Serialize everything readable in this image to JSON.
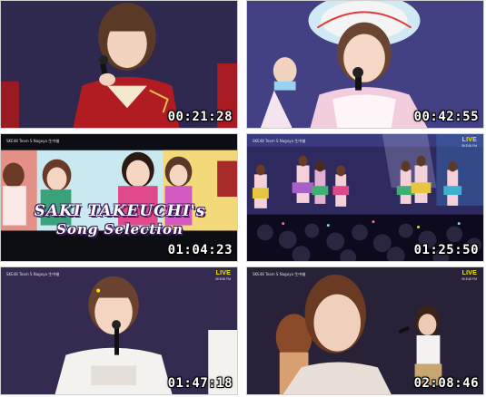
{
  "thumbnails": [
    {
      "timestamp": "00:21:28",
      "show_overlay": false,
      "icon": "person-with-mic"
    },
    {
      "timestamp": "00:42:55",
      "show_overlay": false,
      "icon": "person-with-mic"
    },
    {
      "timestamp": "01:04:23",
      "show_overlay": true,
      "icon": "music-video-collage",
      "caption_line1": "SAKI TAKEUCHI's",
      "caption_line2": "Song Selection"
    },
    {
      "timestamp": "01:25:50",
      "show_overlay": true,
      "icon": "stage-performance"
    },
    {
      "timestamp": "01:47:18",
      "show_overlay": true,
      "icon": "person-with-mic"
    },
    {
      "timestamp": "02:08:46",
      "show_overlay": true,
      "icon": "stage-performance"
    }
  ],
  "overlay": {
    "channel_text": "SKE48 Team S Nagoya 生中継",
    "live_label": "LIVE",
    "live_sub": "SKE48 FM"
  },
  "colors": {
    "timestamp": "#ffffff",
    "live": "#f2e600",
    "stage_bg": "#1d1a3a",
    "caption_outline": "#3b1a58"
  }
}
